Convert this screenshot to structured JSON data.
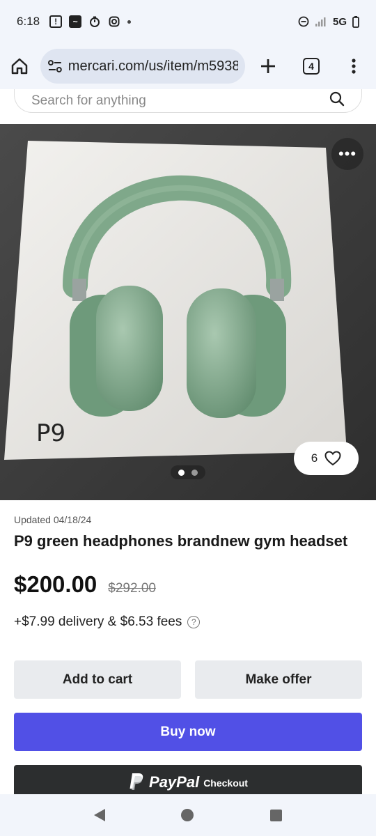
{
  "status_bar": {
    "time": "6:18",
    "network": "5G"
  },
  "browser": {
    "url": "mercari.com/us/item/m5938",
    "tab_count": "4"
  },
  "search": {
    "placeholder": "Search for anything"
  },
  "photo": {
    "box_print": "P9",
    "like_count": "6",
    "dots_total": 2,
    "dots_active": 1
  },
  "listing": {
    "updated": "Updated 04/18/24",
    "title": "P9 green headphones brandnew gym headset",
    "price": "$200.00",
    "original_price": "$292.00",
    "fees": "+$7.99 delivery & $6.53 fees"
  },
  "actions": {
    "add_to_cart": "Add to cart",
    "make_offer": "Make offer",
    "buy_now": "Buy now",
    "paypal_logo": "PayPal",
    "paypal_checkout": "Checkout"
  },
  "colors": {
    "buy_now": "#5150e6",
    "paypal_bg": "#2c2e2f",
    "headphone_green": "#7fa88a"
  }
}
